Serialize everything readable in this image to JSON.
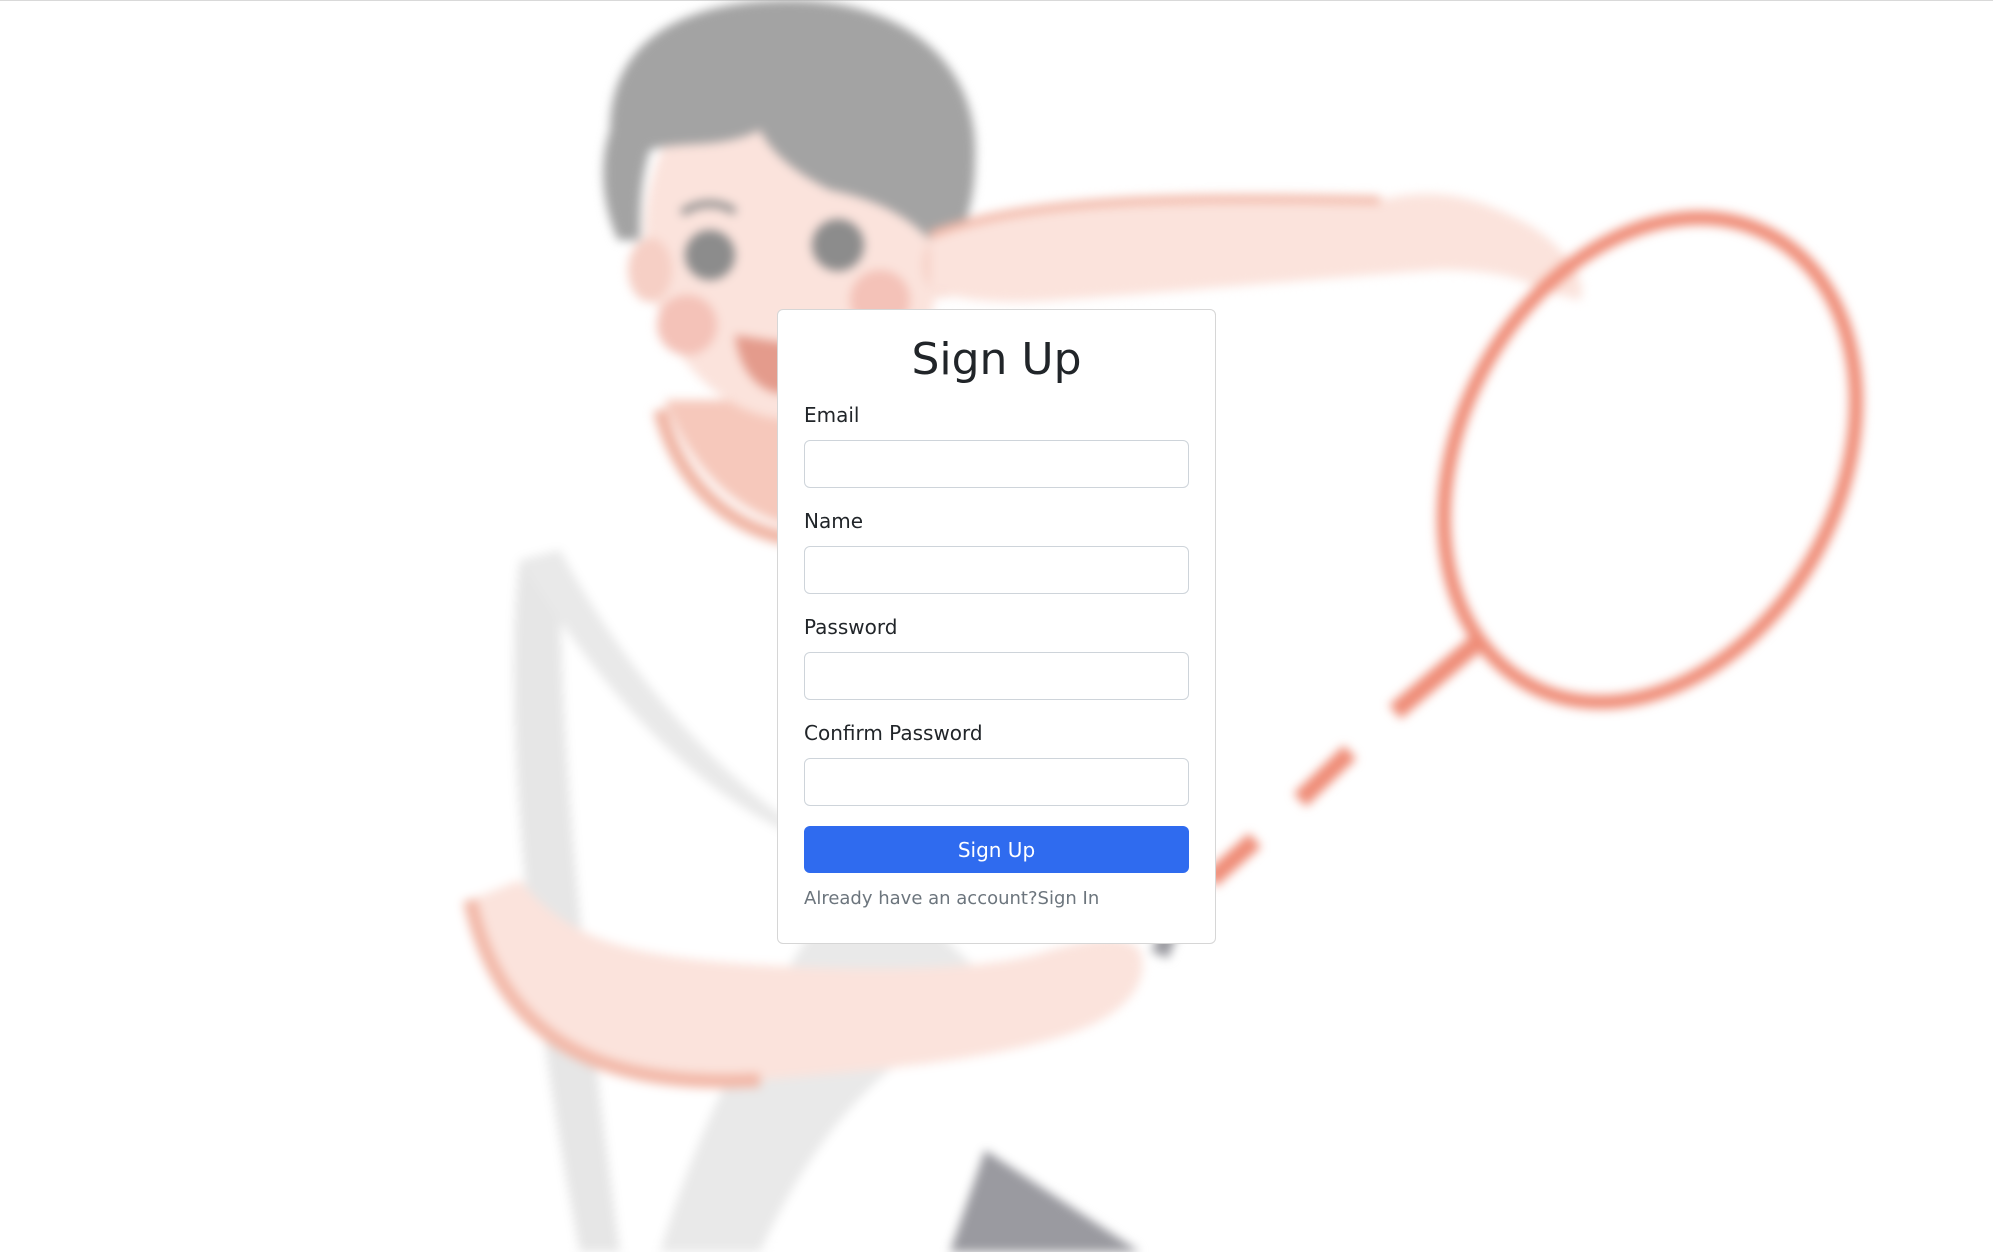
{
  "form": {
    "title": "Sign Up",
    "email_label": "Email",
    "email_value": "",
    "name_label": "Name",
    "name_value": "",
    "password_label": "Password",
    "password_value": "",
    "confirm_password_label": "Confirm Password",
    "confirm_password_value": "",
    "submit_label": "Sign Up",
    "signin_prompt": "Already have an account?",
    "signin_link": "Sign In"
  },
  "colors": {
    "accent": "#2f6bef",
    "background_illustration": "#f08a76"
  },
  "background": {
    "icon": "badminton-player-illustration"
  }
}
